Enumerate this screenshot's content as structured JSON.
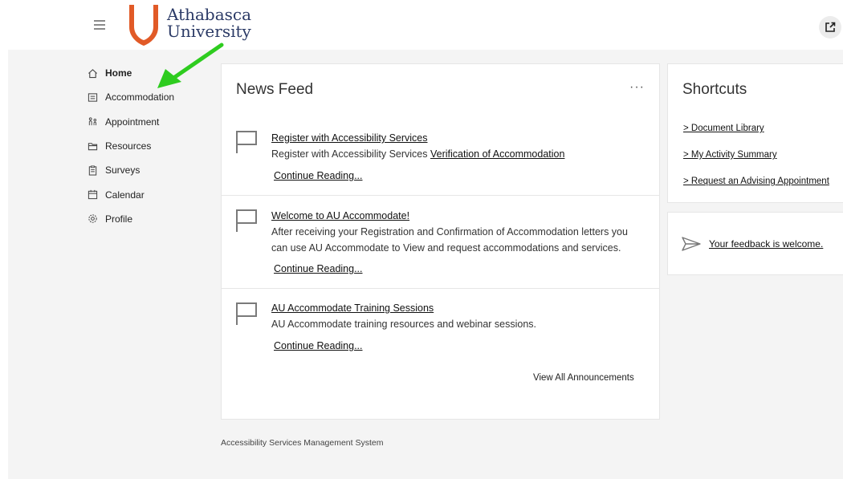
{
  "header": {
    "logo_line1": "Athabasca",
    "logo_line2": "University",
    "menu_icon": "hamburger-icon",
    "external_icon": "external-link-icon",
    "brand_color": "#e15a27"
  },
  "sidebar": {
    "items": [
      {
        "label": "Home",
        "icon": "home-icon",
        "active": true
      },
      {
        "label": "Accommodation",
        "icon": "list-icon"
      },
      {
        "label": "Appointment",
        "icon": "appointment-icon"
      },
      {
        "label": "Resources",
        "icon": "folder-icon"
      },
      {
        "label": "Surveys",
        "icon": "clipboard-icon"
      },
      {
        "label": "Calendar",
        "icon": "calendar-icon"
      },
      {
        "label": "Profile",
        "icon": "gear-icon"
      }
    ]
  },
  "annotation": {
    "arrow_color": "#2ecc1f"
  },
  "news": {
    "title": "News Feed",
    "more": "···",
    "items": [
      {
        "title": "Register with Accessibility Services",
        "text": "Register with Accessibility Services ",
        "inline_link": "Verification of Accommodation",
        "continue": "Continue Reading..."
      },
      {
        "title": "Welcome to AU Accommodate!",
        "text": "After receiving your Registration and Confirmation of Accommodation letters you can use AU Accommodate to View and request accommodations and services.",
        "continue": "Continue Reading..."
      },
      {
        "title": "AU Accommodate Training Sessions",
        "text": "AU Accommodate training resources and webinar sessions.",
        "continue": "Continue Reading..."
      }
    ],
    "view_all": "View All Announcements"
  },
  "shortcuts": {
    "title": "Shortcuts",
    "items": [
      "> Document Library",
      "> My Activity Summary",
      "> Request an Advising Appointment"
    ]
  },
  "feedback": {
    "icon": "send-icon",
    "link": "Your feedback is welcome."
  },
  "footer": {
    "text": "Accessibility Services Management System"
  }
}
